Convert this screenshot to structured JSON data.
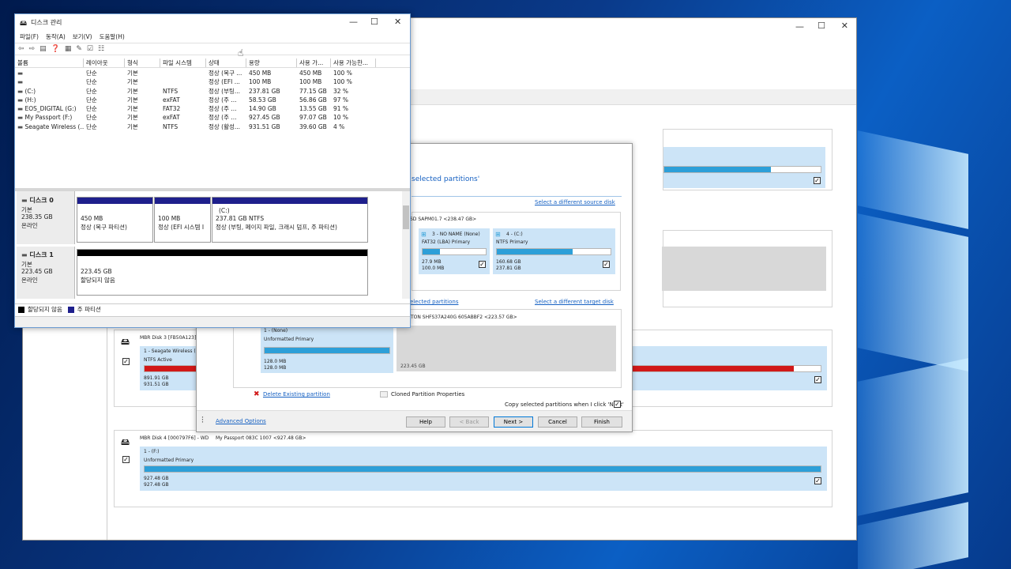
{
  "colors": {
    "accent": "#2d9fd8",
    "danger": "#d11818",
    "primary_partition": "#1e1f8c",
    "unallocated": "#000000"
  },
  "back_window": {
    "scrollbar": "",
    "disks": [
      {
        "header": "MBR Disk 3 [FB50A123] -",
        "part_name": "1 - Seagate Wireless (Dr",
        "part_fs": "NTFS Active",
        "size1": "891.91 GB",
        "size2": "931.51 GB"
      },
      {
        "header": "MBR Disk 4 [000797F6] - WD",
        "header2": "My Passport 083C 1007  <927.48 GB>",
        "part_name": "1 - (F:)",
        "part_fs": "Unformatted Primary",
        "size1": "927.48 GB",
        "size2": "927.48 GB"
      }
    ]
  },
  "wizard": {
    "heading_fragment": "selected partitions'",
    "select_source": "Select a different source disk",
    "source_disk": "SD SAPM01.7  <238.47 GB>",
    "source_parts": [
      {
        "name": "3 - NO NAME (None)",
        "fs": "FAT32 (LBA) Primary",
        "used": "27.9 MB",
        "total": "100.0 MB",
        "fill": 0.28
      },
      {
        "name": "4 - (C:)",
        "fs": "NTFS Primary",
        "used": "160.68 GB",
        "total": "237.81 GB",
        "fill": 0.67
      }
    ],
    "selected_partitions": "elected partitions",
    "select_target": "Select a different target disk",
    "target_disk": "TON SHFS37A240G 605ABBF2  <223.57 GB>",
    "target_part": {
      "name": "1 - (None)",
      "fs": "Unformatted Primary",
      "size1": "128.0 MB",
      "size2": "128.0 MB"
    },
    "unallocated_size": "223.45 GB",
    "delete_partition": "Delete Existing partition",
    "cloned_props": "Cloned Partition Properties",
    "copy_label": "Copy selected partitions when I click 'Next'",
    "advanced": "Advanced Options",
    "buttons": {
      "help": "Help",
      "back": "< Back",
      "next": "Next >",
      "cancel": "Cancel",
      "finish": "Finish"
    }
  },
  "disk_mgmt": {
    "title": "디스크 관리",
    "menu": [
      "파일(F)",
      "동작(A)",
      "보기(V)",
      "도움말(H)"
    ],
    "columns": [
      "볼륨",
      "레이아웃",
      "형식",
      "파일 시스템",
      "상태",
      "용량",
      "사용 가...",
      "사용 가능한..."
    ],
    "rows": [
      [
        "",
        "단순",
        "기본",
        "",
        "정상 (복구 ...",
        "450 MB",
        "450 MB",
        "100 %"
      ],
      [
        "",
        "단순",
        "기본",
        "",
        "정상 (EFI ...",
        "100 MB",
        "100 MB",
        "100 %"
      ],
      [
        "(C:)",
        "단순",
        "기본",
        "NTFS",
        "정상 (부팅...",
        "237.81 GB",
        "77.15 GB",
        "32 %"
      ],
      [
        "(H:)",
        "단순",
        "기본",
        "exFAT",
        "정상 (주 ...",
        "58.53 GB",
        "56.86 GB",
        "97 %"
      ],
      [
        "EOS_DIGITAL (G:)",
        "단순",
        "기본",
        "FAT32",
        "정상 (주 ...",
        "14.90 GB",
        "13.55 GB",
        "91 %"
      ],
      [
        "My Passport (F:)",
        "단순",
        "기본",
        "exFAT",
        "정상 (주 ...",
        "927.45 GB",
        "97.07 GB",
        "10 %"
      ],
      [
        "Seagate Wireless (...",
        "단순",
        "기본",
        "NTFS",
        "정상 (활성...",
        "931.51 GB",
        "39.60 GB",
        "4 %"
      ]
    ],
    "disk0": {
      "name": "디스크 0",
      "type": "기본",
      "size": "238.35 GB",
      "status": "온라인",
      "vols": [
        {
          "size": "450 MB",
          "status": "정상 (복구 파티션)"
        },
        {
          "size": "100 MB",
          "status": "정상 (EFI 시스템 I"
        },
        {
          "label": "(C:)",
          "size": "237.81 GB NTFS",
          "status": "정상 (부팅, 페이지 파일, 크래시 덤프, 주 파티션)"
        }
      ]
    },
    "disk1": {
      "name": "디스크 1",
      "type": "기본",
      "size": "223.45 GB",
      "status": "온라인",
      "vol_size": "223.45 GB",
      "vol_status": "할당되지 않음"
    },
    "legend": {
      "unallocated": "할당되지 않음",
      "primary": "주 파티션"
    }
  }
}
